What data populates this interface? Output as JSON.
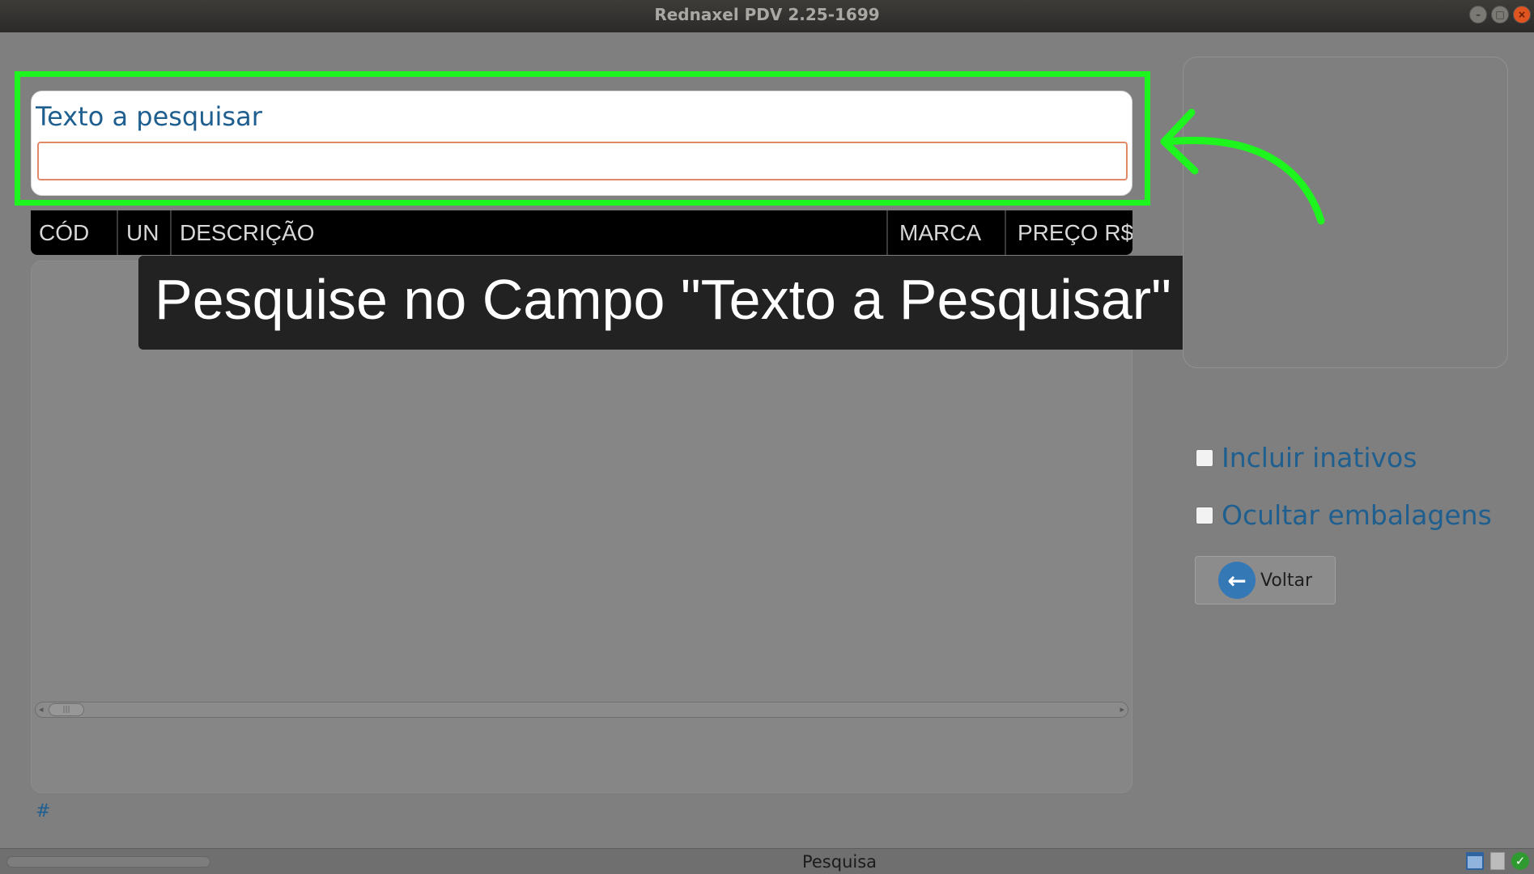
{
  "window": {
    "title": "Rednaxel PDV 2.25-1699",
    "buttons": [
      "–",
      "□",
      "×"
    ]
  },
  "search": {
    "label": "Texto a pesquisar",
    "value": "",
    "highlight_color": "#1ef51e"
  },
  "table": {
    "columns": [
      "CÓD",
      "UN",
      "DESCRIÇÃO",
      "MARCA",
      "PREÇO R$"
    ],
    "rows": [],
    "scroll_thumb": "|||"
  },
  "caption": {
    "text": "Pesquise no Campo \"Texto a Pesquisar\""
  },
  "options": {
    "include_inactive": {
      "label": "Incluir inativos",
      "checked": false
    },
    "hide_packaging": {
      "label": "Ocultar embalagens",
      "checked": false
    }
  },
  "back_button": {
    "label": "Voltar",
    "icon": "arrow-left-icon"
  },
  "footer": {
    "hash": "#"
  },
  "statusbar": {
    "text": "Pesquisa",
    "ok_glyph": "✓"
  },
  "colors": {
    "accent_text": "#1e5f8f",
    "input_border": "#e28a68",
    "back_icon_bg": "#3478b6"
  }
}
